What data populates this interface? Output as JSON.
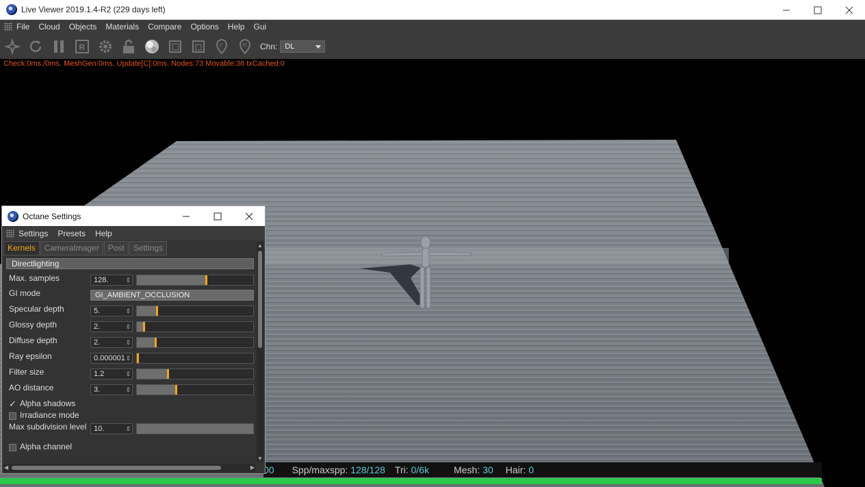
{
  "window": {
    "title": "Live Viewer 2019.1.4-R2 (229 days left)"
  },
  "menubar": {
    "items": [
      "File",
      "Cloud",
      "Objects",
      "Materials",
      "Compare",
      "Options",
      "Help",
      "Gui"
    ]
  },
  "toolbar": {
    "icons": [
      "send-scene-icon",
      "restart-icon",
      "pause-icon",
      "region-render-icon",
      "settings-gear-icon",
      "lock-icon",
      "material-ball-icon",
      "film-region-icon",
      "clay-mode-icon",
      "pick-focus-icon",
      "pick-material-icon"
    ],
    "channel_label": "Chn:",
    "channel_value": "DL"
  },
  "viewport": {
    "stats": "Check:0ms./0ms. MeshGen:0ms. Update[C]:0ms. Nodes:73 Movable:36 txCached:0"
  },
  "statusbar": {
    "partial": "00",
    "spp_label": "Spp/maxspp:",
    "spp_value": "128/128",
    "tri_label": "Tri:",
    "tri_value": "0/6k",
    "mesh_label": "Mesh:",
    "mesh_value": "30",
    "hair_label": "Hair:",
    "hair_value": "0",
    "progress": 1.0
  },
  "octane": {
    "title": "Octane Settings",
    "menu": [
      "Settings",
      "Presets",
      "Help"
    ],
    "tabs": [
      "Kernels",
      "CameraImager",
      "Post",
      "Settings"
    ],
    "section": "Directlighting",
    "params": [
      {
        "label": "Max. samples",
        "value": "128.",
        "fraction": 0.6
      },
      {
        "label": "GI mode",
        "value": "GI_AMBIENT_OCCLUSION"
      },
      {
        "label": "Specular depth",
        "value": "5.",
        "fraction": 0.17
      },
      {
        "label": "Glossy depth",
        "value": "2.",
        "fraction": 0.06
      },
      {
        "label": "Diffuse depth",
        "value": "2.",
        "fraction": 0.16
      },
      {
        "label": "Ray epsilon",
        "value": "0.000001",
        "fraction": 0.0
      },
      {
        "label": "Filter size",
        "value": "1.2",
        "fraction": 0.27
      },
      {
        "label": "AO distance",
        "value": "3.",
        "fraction": 0.34
      }
    ],
    "alpha_shadows": {
      "label": "Alpha shadows",
      "checked": true
    },
    "irradiance_mode": {
      "label": "Irradiance mode",
      "checked": false
    },
    "max_subdiv": {
      "label": "Max subdivision level",
      "value": "10.",
      "fraction": 1.0
    },
    "alpha_channel": {
      "label": "Alpha channel",
      "checked": false
    }
  },
  "colors": {
    "accent": "#f2a51c",
    "progress": "#2cc84a",
    "stats": "#e0531f",
    "status_value": "#5ac8d8"
  }
}
